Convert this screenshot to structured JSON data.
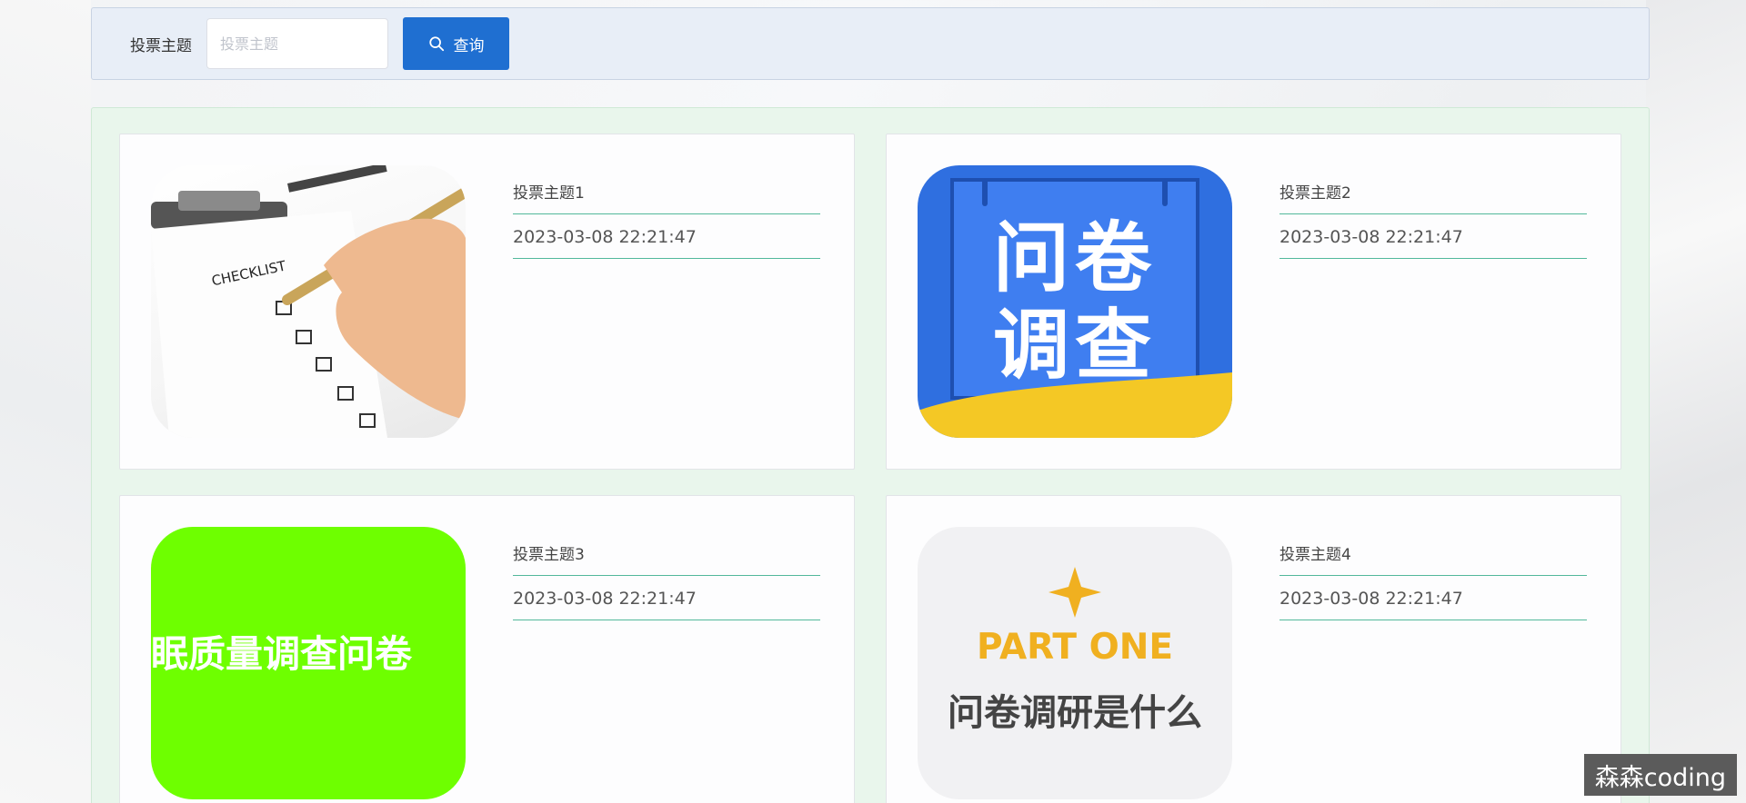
{
  "search": {
    "label": "投票主题",
    "placeholder": "投票主题",
    "button_label": "查询"
  },
  "cards": [
    {
      "title": "投票主题1",
      "time": "2023-03-08 22:21:47",
      "image": {
        "label": "CHECKLIST"
      }
    },
    {
      "title": "投票主题2",
      "time": "2023-03-08 22:21:47",
      "image": {
        "line1": "问卷",
        "line2": "调查"
      }
    },
    {
      "title": "投票主题3",
      "time": "2023-03-08 22:21:47",
      "image": {
        "label": "眠质量调查问卷"
      }
    },
    {
      "title": "投票主题4",
      "time": "2023-03-08 22:21:47",
      "image": {
        "line1": "PART ONE",
        "line2": "问卷调研是什么"
      }
    }
  ],
  "watermark": "森森coding",
  "colors": {
    "primary": "#1f6fd1",
    "divider": "#52b89b",
    "panel_bg": "#e9f6ec",
    "search_bg": "#e8eef7"
  }
}
